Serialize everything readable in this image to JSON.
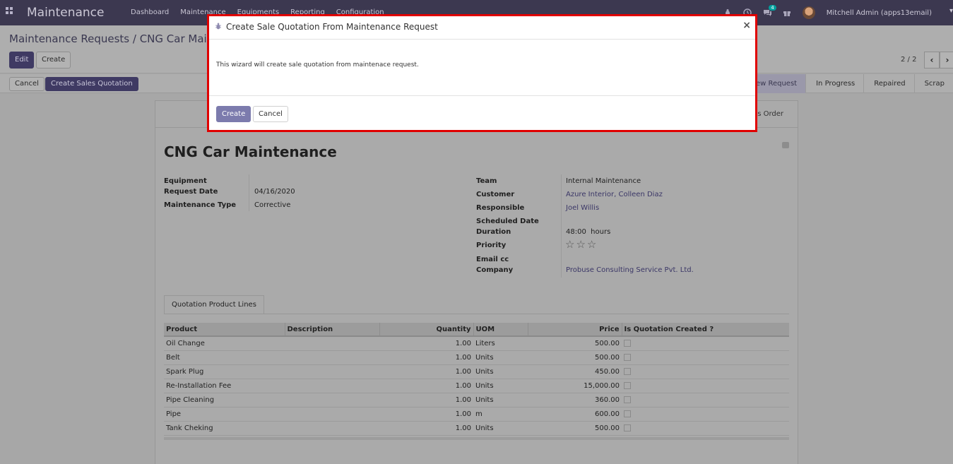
{
  "navbar": {
    "app_name": "Maintenance",
    "menu": [
      "Dashboard",
      "Maintenance",
      "Equipments",
      "Reporting",
      "Configuration"
    ],
    "messages_badge": "4",
    "user": "Mitchell Admin (apps13email)"
  },
  "control": {
    "breadcrumb": "Maintenance Requests / CNG Car Maintenance",
    "edit_label": "Edit",
    "create_label": "Create",
    "pager": "2 / 2",
    "prev_glyph": "‹",
    "next_glyph": "›"
  },
  "statusbar": {
    "cancel_label": "Cancel",
    "create_quotation_label": "Create Sales Quotation",
    "stages": [
      "New Request",
      "In Progress",
      "Repaired",
      "Scrap"
    ],
    "active_stage": "New Request"
  },
  "form": {
    "smart_button": "Sales Order",
    "title": "CNG Car Maintenance",
    "left": {
      "equipment_label": "Equipment",
      "equipment_value": "",
      "request_date_label": "Request Date",
      "request_date_value": "04/16/2020",
      "maintenance_type_label": "Maintenance Type",
      "maintenance_type_value": "Corrective"
    },
    "right": {
      "team_label": "Team",
      "team_value": "Internal Maintenance",
      "customer_label": "Customer",
      "customer_value": "Azure Interior, Colleen Diaz",
      "responsible_label": "Responsible",
      "responsible_value": "Joel Willis",
      "scheduled_date_label": "Scheduled Date",
      "duration_label": "Duration",
      "duration_value": "48:00  hours",
      "priority_label": "Priority",
      "priority_stars": "☆☆☆",
      "email_cc_label": "Email cc",
      "company_label": "Company",
      "company_value": "Probuse Consulting Service Pvt. Ltd."
    },
    "tab_label": "Quotation Product Lines",
    "table": {
      "headers": [
        "Product",
        "Description",
        "Quantity",
        "UOM",
        "Price",
        "Is Quotation Created ?"
      ],
      "rows": [
        {
          "product": "Oil Change",
          "description": "",
          "quantity": "1.00",
          "uom": "Liters",
          "price": "500.00"
        },
        {
          "product": "Belt",
          "description": "",
          "quantity": "1.00",
          "uom": "Units",
          "price": "500.00"
        },
        {
          "product": "Spark Plug",
          "description": "",
          "quantity": "1.00",
          "uom": "Units",
          "price": "450.00"
        },
        {
          "product": "Re-Installation Fee",
          "description": "",
          "quantity": "1.00",
          "uom": "Units",
          "price": "15,000.00"
        },
        {
          "product": "Pipe Cleaning",
          "description": "",
          "quantity": "1.00",
          "uom": "Units",
          "price": "360.00"
        },
        {
          "product": "Pipe",
          "description": "",
          "quantity": "1.00",
          "uom": "m",
          "price": "600.00"
        },
        {
          "product": "Tank Cheking",
          "description": "",
          "quantity": "1.00",
          "uom": "Units",
          "price": "500.00"
        }
      ]
    }
  },
  "modal": {
    "title": "Create Sale Quotation From Maintenance Request",
    "close_glyph": "×",
    "body": "This wizard will create sale quotation from maintenace request.",
    "create_label": "Create",
    "cancel_label": "Cancel"
  }
}
